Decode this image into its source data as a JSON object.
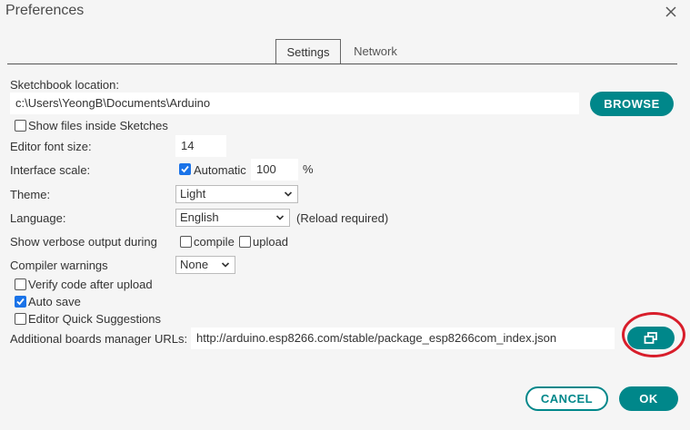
{
  "window": {
    "title": "Preferences"
  },
  "tabs": [
    {
      "label": "Settings"
    },
    {
      "label": "Network"
    }
  ],
  "sketchbook": {
    "label": "Sketchbook location:",
    "path": "c:\\Users\\YeongB\\Documents\\Arduino",
    "browse_label": "BROWSE",
    "show_files_label": "Show files inside Sketches",
    "show_files_checked": false
  },
  "editor_font": {
    "label": "Editor font size:",
    "value": "14"
  },
  "interface_scale": {
    "label": "Interface scale:",
    "automatic_label": "Automatic",
    "automatic_checked": true,
    "value": "100",
    "unit": "%"
  },
  "theme": {
    "label": "Theme:",
    "value": "Light"
  },
  "language": {
    "label": "Language:",
    "value": "English",
    "note": "(Reload required)"
  },
  "verbose": {
    "label": "Show verbose output during",
    "compile_label": "compile",
    "compile_checked": false,
    "upload_label": "upload",
    "upload_checked": false
  },
  "compiler_warnings": {
    "label": "Compiler warnings",
    "value": "None"
  },
  "options": [
    {
      "label": "Verify code after upload",
      "checked": false
    },
    {
      "label": "Auto save",
      "checked": true
    },
    {
      "label": "Editor Quick Suggestions",
      "checked": false
    }
  ],
  "boards_urls": {
    "label": "Additional boards manager URLs:",
    "value": "http://arduino.esp8266.com/stable/package_esp8266com_index.json"
  },
  "footer": {
    "cancel_label": "CANCEL",
    "ok_label": "OK"
  },
  "colors": {
    "accent": "#00878a",
    "highlight_ring": "#d81e2b",
    "checkbox_checked": "#1a73e8"
  },
  "icons": {
    "close": "close-icon",
    "open_window": "open-window-icon"
  }
}
